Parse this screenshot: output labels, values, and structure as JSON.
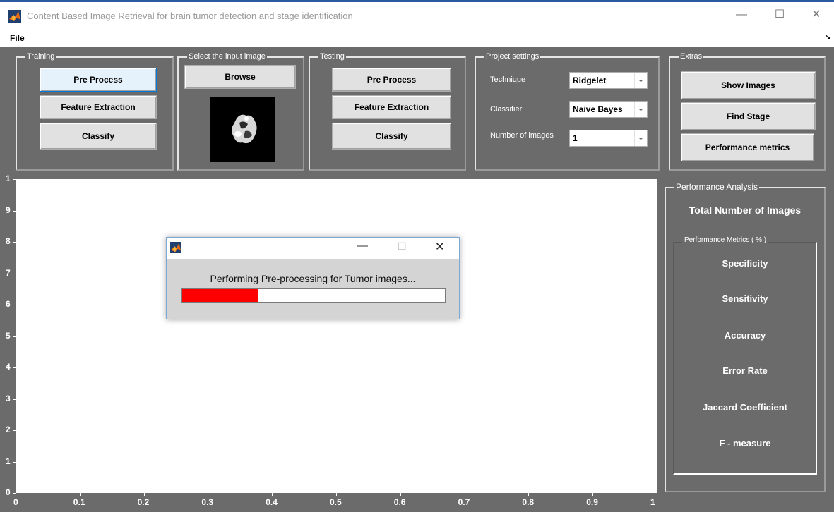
{
  "window": {
    "title": "Content Based Image Retrieval for brain tumor detection and stage identification",
    "minimize": "—",
    "maximize": "☐",
    "close": "✕"
  },
  "menu": {
    "file": "File",
    "corner": "↘"
  },
  "training": {
    "title": "Training",
    "preprocess": "Pre Process",
    "feature": "Feature Extraction",
    "classify": "Classify"
  },
  "input": {
    "title": "Select the input image",
    "browse": "Browse"
  },
  "testing": {
    "title": "Testing",
    "preprocess": "Pre Process",
    "feature": "Feature Extraction",
    "classify": "Classify"
  },
  "settings": {
    "title": "Project settings",
    "technique_label": "Technique",
    "technique_value": "Ridgelet",
    "classifier_label": "Classifier",
    "classifier_value": "Naive Bayes",
    "images_label": "Number of images",
    "images_value": "1"
  },
  "extras": {
    "title": "Extras",
    "show_images": "Show Images",
    "find_stage": "Find Stage",
    "perf_metrics": "Performance metrics"
  },
  "axes": {
    "yticks": [
      "0",
      "1",
      "2",
      "3",
      "4",
      "5",
      "6",
      "7",
      "8",
      "9",
      "1"
    ],
    "xticks": [
      "0",
      "0.1",
      "0.2",
      "0.3",
      "0.4",
      "0.5",
      "0.6",
      "0.7",
      "0.8",
      "0.9",
      "1"
    ]
  },
  "performance": {
    "title": "Performance Analysis",
    "total": "Total Number of Images",
    "metrics_title": "Performance Metrics ( % )",
    "items": [
      "Specificity",
      "Sensitivity",
      "Accuracy",
      "Error Rate",
      "Jaccard Coefficient",
      "F - measure"
    ]
  },
  "dialog": {
    "message": "Performing Pre-processing for Tumor images...",
    "progress": 0.29,
    "minimize": "—",
    "maximize": "☐",
    "close": "✕"
  },
  "colors": {
    "background": "#6b6b6b",
    "progress_fill": "#ff0000",
    "button_focus": "#e5f1fb"
  },
  "icons": {
    "app": "matlab-icon",
    "dropdown": "chevron-down-icon"
  }
}
